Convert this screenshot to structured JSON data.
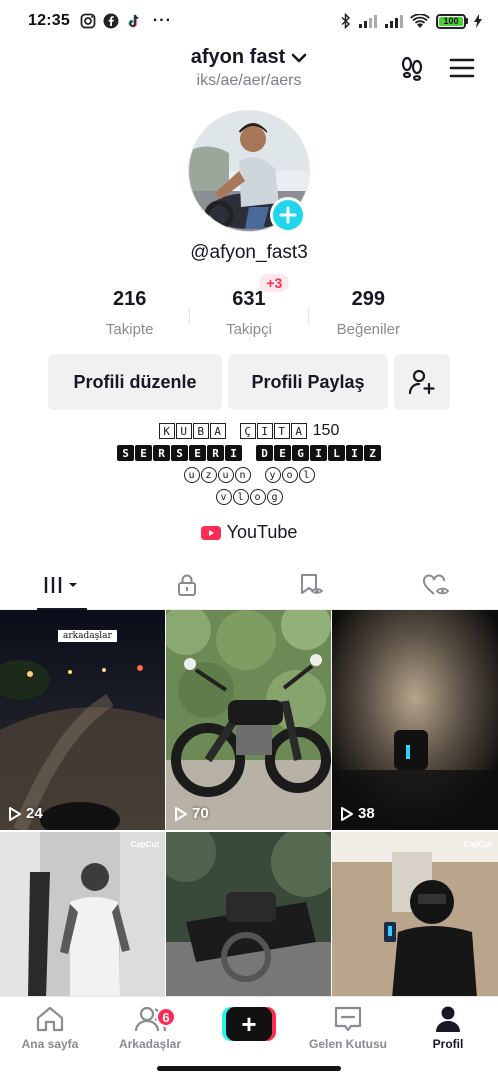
{
  "status_bar": {
    "time": "12:35",
    "battery": "100",
    "left_icons": [
      "instagram-icon",
      "facebook-icon",
      "tiktok-icon"
    ],
    "right_icons": [
      "bluetooth-icon",
      "signal-icon",
      "signal-icon",
      "wifi-icon",
      "battery-icon",
      "charging-icon"
    ]
  },
  "header": {
    "username": "afyon fast",
    "subtitle": "iks/ae/aer/aers"
  },
  "profile": {
    "handle": "@afyon_fast3"
  },
  "stats": {
    "following": {
      "value": "216",
      "label": "Takipte"
    },
    "followers": {
      "value": "631",
      "label": "Takipçi",
      "delta": "+3"
    },
    "likes": {
      "value": "299",
      "label": "Beğeniler"
    }
  },
  "buttons": {
    "edit_profile": "Profili düzenle",
    "share_profile": "Profili Paylaş"
  },
  "bio": {
    "line1_boxed_a": [
      "K",
      "U",
      "B",
      "A"
    ],
    "line1_boxed_b": [
      "Ç",
      "I",
      "T",
      "A"
    ],
    "line1_number": "150",
    "line2_filled_a": [
      "S",
      "E",
      "R",
      "S",
      "E",
      "R",
      "I"
    ],
    "line2_filled_b": [
      "D",
      "E",
      "G",
      "I",
      "L",
      "I",
      "Z"
    ],
    "line3_circled_a": [
      "u",
      "z",
      "u",
      "n"
    ],
    "line3_circled_b": [
      "y",
      "o",
      "l"
    ],
    "line4_circled": [
      "v",
      "l",
      "o",
      "g"
    ],
    "link": "YouTube"
  },
  "tabs": [
    "videos-grid-icon",
    "lock-icon",
    "bookmark-icon",
    "liked-icon"
  ],
  "grid": [
    {
      "views": "24",
      "caption": "arkadaşlar"
    },
    {
      "views": "70"
    },
    {
      "views": "38"
    },
    {
      "watermark": "CapCut"
    },
    {},
    {
      "watermark": "CapCut"
    }
  ],
  "nav": {
    "home": "Ana sayfa",
    "friends": "Arkadaşlar",
    "friends_badge": "6",
    "create": "+",
    "inbox": "Gelen Kutusu",
    "profile": "Profil"
  },
  "colors": {
    "accent_red": "#fe2c55",
    "accent_cyan": "#20d5ec",
    "text_primary": "#161823",
    "text_secondary": "#8a8b91",
    "button_bg": "#f1f1f2"
  }
}
